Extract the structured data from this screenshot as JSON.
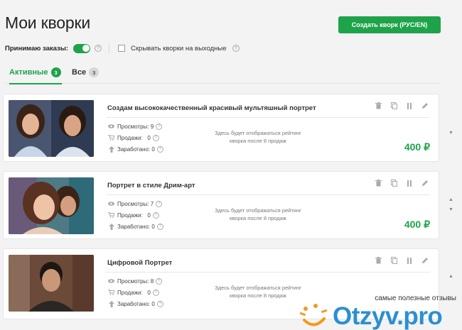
{
  "header": {
    "title": "Мои кворки",
    "create_button": "Создать кворк (РУС/EN)"
  },
  "controls": {
    "accept_orders_label": "Принимаю заказы:",
    "accept_orders_on": true,
    "hide_weekends_label": "Скрывать кворки на выходные",
    "hide_weekends_checked": false,
    "help_glyph": "?"
  },
  "tabs": [
    {
      "label": "Активные",
      "count": "3",
      "active": true
    },
    {
      "label": "Все",
      "count": "3",
      "active": false
    }
  ],
  "stat_labels": {
    "views": "Просмотры:",
    "sales": "Продажи:",
    "earned": "Заработано:"
  },
  "rating_note": "Здесь будет отображаться рейтинг кворка после 8 продаж",
  "kworks": [
    {
      "title": "Создам высококачественный красивый мультяшный портрет",
      "views": "9",
      "sales": "0",
      "earned": "0",
      "price": "400 ₽"
    },
    {
      "title": "Портрет в стиле Дрим-арт",
      "views": "7",
      "sales": "0",
      "earned": "0",
      "price": "400 ₽"
    },
    {
      "title": "Цифровой Портрет",
      "views": "8",
      "sales": "0",
      "earned": "0",
      "price": ""
    }
  ],
  "watermark": {
    "caption": "самые полезные отзывы",
    "logo_text": "Otzyv.pro"
  },
  "colors": {
    "accent": "#1ea34a",
    "logo_blue": "#2c8fcf",
    "logo_orange": "#f39a1c"
  }
}
